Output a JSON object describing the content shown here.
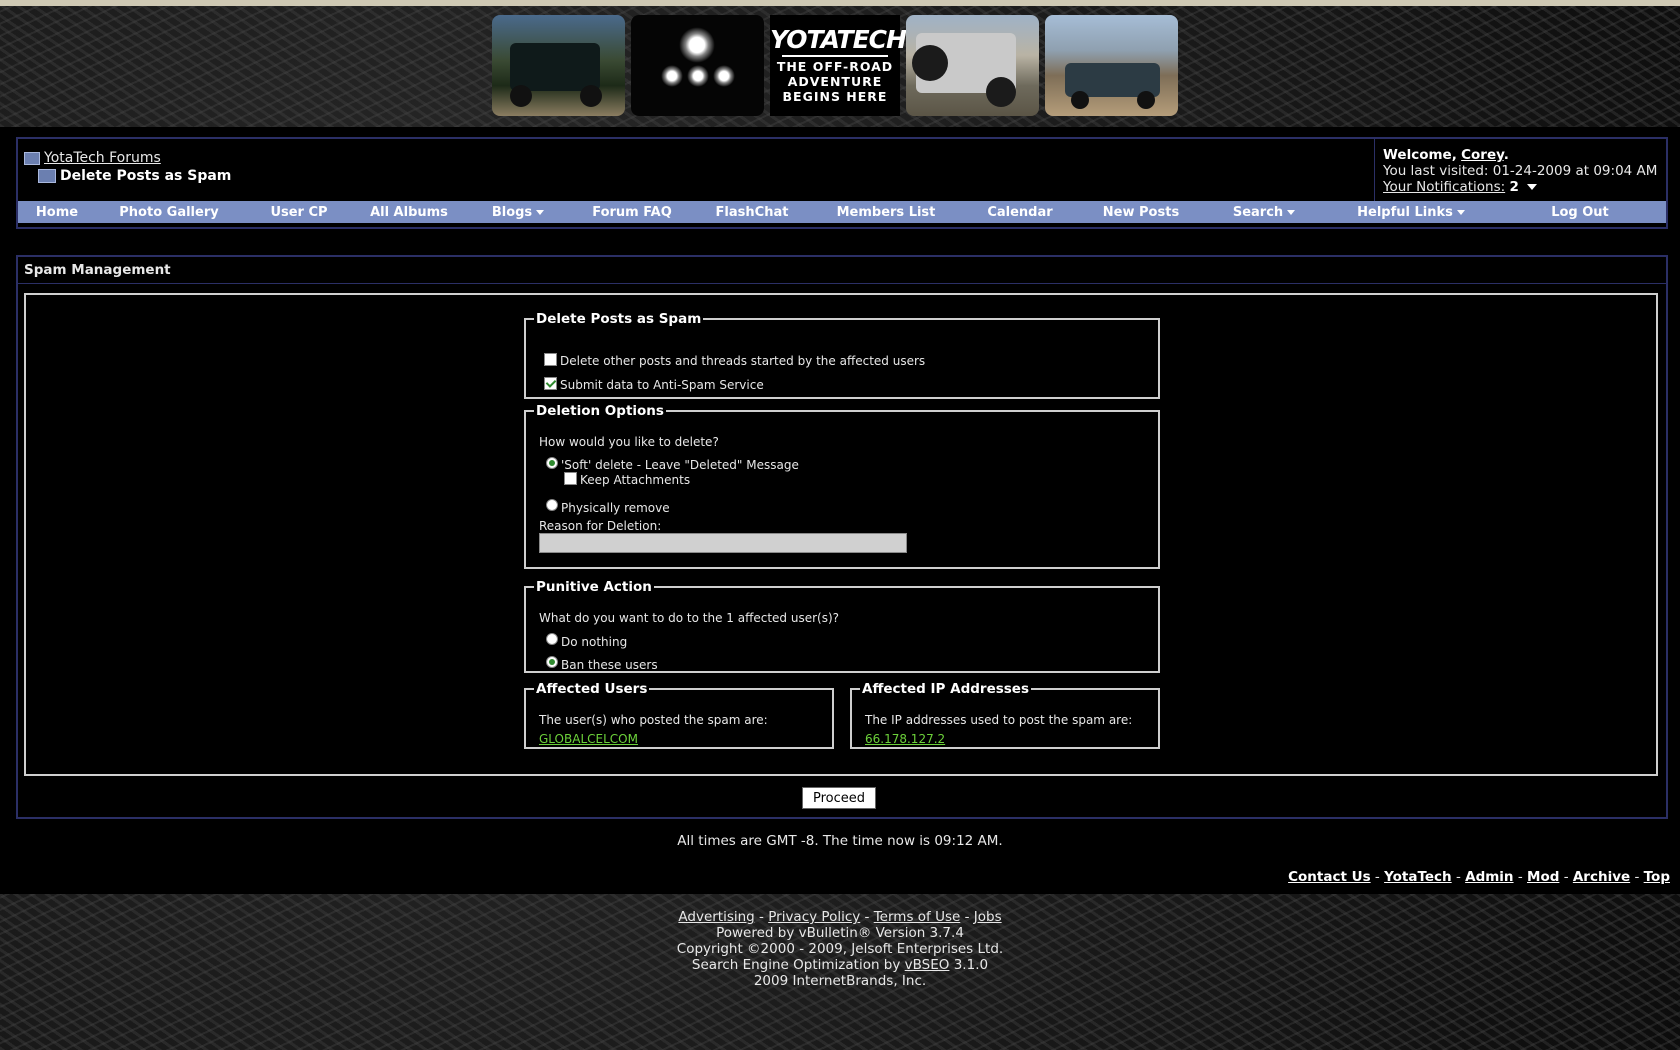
{
  "banner": {
    "logo_title": "YOTATECH",
    "tagline_1": "THE OFF-ROAD",
    "tagline_2": "ADVENTURE",
    "tagline_3": "BEGINS HERE"
  },
  "breadcrumb": {
    "root": "YotaTech Forums",
    "current": "Delete Posts as Spam"
  },
  "welcome": {
    "prefix": "Welcome,",
    "username": "Corey",
    "suffix": ".",
    "last_visited_label": "You last visited: 01-24-2009 at",
    "last_visited_time": "09:04 AM",
    "notifications_label": "Your Notifications:",
    "notifications_count": "2"
  },
  "navbar": {
    "items": [
      {
        "label": "Home"
      },
      {
        "label": "Photo Gallery"
      },
      {
        "label": "User CP"
      },
      {
        "label": "All Albums"
      },
      {
        "label": "Blogs"
      },
      {
        "label": "Forum FAQ"
      },
      {
        "label": "FlashChat"
      },
      {
        "label": "Members List"
      },
      {
        "label": "Calendar"
      },
      {
        "label": "New Posts"
      },
      {
        "label": "Search"
      },
      {
        "label": "Helpful Links"
      },
      {
        "label": "Log Out"
      }
    ]
  },
  "spam": {
    "title": "Spam Management",
    "delete_section": {
      "legend": "Delete Posts as Spam",
      "opt_delete_other": "Delete other posts and threads started by the affected users",
      "opt_delete_other_checked": false,
      "opt_submit": "Submit data to Anti-Spam Service",
      "opt_submit_checked": true
    },
    "deletion_options": {
      "legend": "Deletion Options",
      "question": "How would you like to delete?",
      "soft_delete": "'Soft' delete - Leave \"Deleted\" Message",
      "keep_attachments": "Keep Attachments",
      "physically_remove": "Physically remove",
      "reason_label": "Reason for Deletion:",
      "reason_value": ""
    },
    "punitive": {
      "legend": "Punitive Action",
      "question": "What do you want to do to the 1 affected user(s)?",
      "do_nothing": "Do nothing",
      "ban_users": "Ban these users"
    },
    "affected_users": {
      "legend": "Affected Users",
      "text": "The user(s) who posted the spam are:",
      "user": "GLOBALCELCOM"
    },
    "affected_ips": {
      "legend": "Affected IP Addresses",
      "text": "The IP addresses used to post the spam are:",
      "ip": "66.178.127.2"
    },
    "proceed_label": "Proceed"
  },
  "footer": {
    "time_note": "All times are GMT -8. The time now is 09:12 AM.",
    "links": [
      "Contact Us",
      "YotaTech",
      "Admin",
      "Mod",
      "Archive",
      "Top"
    ],
    "separator": "-",
    "legal_links": [
      "Advertising",
      "Privacy Policy",
      "Terms of Use",
      "Jobs"
    ],
    "powered_by": "Powered by vBulletin® Version 3.7.4",
    "copyright": "Copyright ©2000 - 2009, Jelsoft Enterprises Ltd.",
    "seo_prefix": "Search Engine Optimization by",
    "seo_link": "vBSEO",
    "seo_version": "3.1.0",
    "brand_line": "2009 InternetBrands, Inc."
  }
}
